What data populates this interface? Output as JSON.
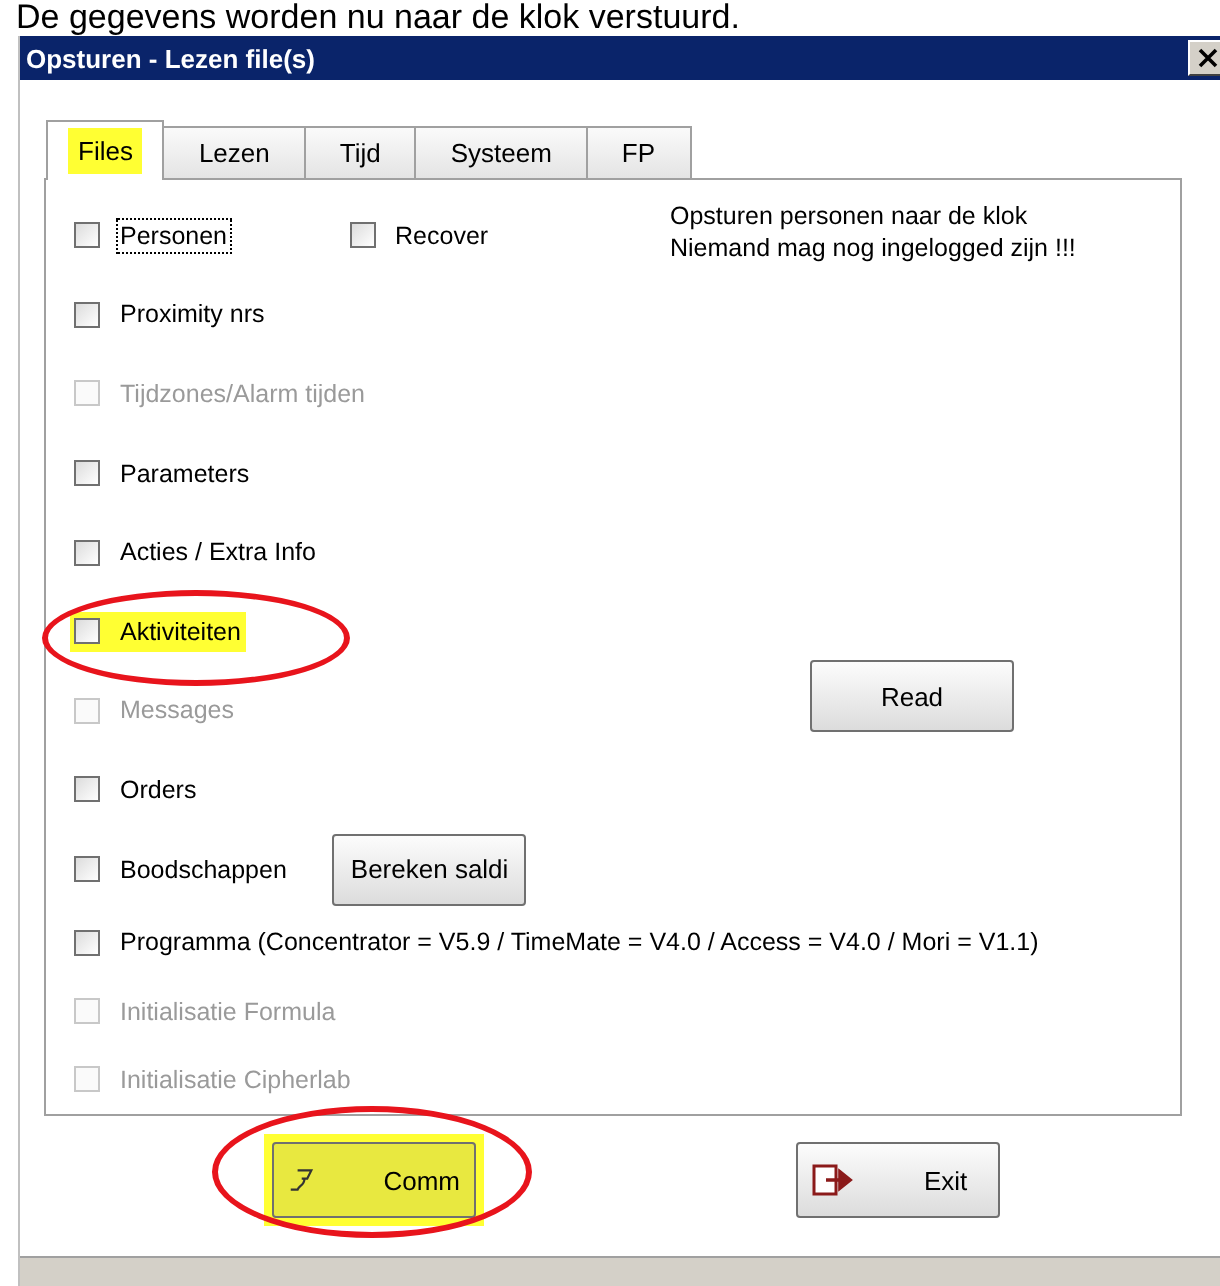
{
  "caption": "De gegevens worden nu naar de klok verstuurd.",
  "window": {
    "title": "Opsturen - Lezen  file(s)"
  },
  "tabs": [
    {
      "label": "Files",
      "selected": true,
      "highlighted": true
    },
    {
      "label": "Lezen",
      "selected": false,
      "highlighted": false
    },
    {
      "label": "Tijd",
      "selected": false,
      "highlighted": false
    },
    {
      "label": "Systeem",
      "selected": false,
      "highlighted": false
    },
    {
      "label": "FP",
      "selected": false,
      "highlighted": false
    }
  ],
  "info_text": [
    "Opsturen personen naar de klok",
    "Niemand mag nog ingelogged zijn !!!"
  ],
  "read_button": "Read",
  "rows": [
    {
      "items": [
        {
          "kind": "checkbox",
          "label": "Personen",
          "checked": false,
          "disabled": false,
          "focused": true,
          "highlighted": false,
          "circled": false
        },
        {
          "kind": "checkbox",
          "label": "Recover",
          "checked": false,
          "disabled": false,
          "focused": false,
          "highlighted": false,
          "circled": false
        }
      ]
    },
    {
      "items": [
        {
          "kind": "checkbox",
          "label": "Proximity nrs",
          "checked": false,
          "disabled": false,
          "focused": false,
          "highlighted": false,
          "circled": false
        }
      ]
    },
    {
      "items": [
        {
          "kind": "checkbox",
          "label": "Tijdzones/Alarm tijden",
          "checked": false,
          "disabled": true,
          "focused": false,
          "highlighted": false,
          "circled": false
        }
      ]
    },
    {
      "items": [
        {
          "kind": "checkbox",
          "label": "Parameters",
          "checked": false,
          "disabled": false,
          "focused": false,
          "highlighted": false,
          "circled": false
        }
      ]
    },
    {
      "items": [
        {
          "kind": "checkbox",
          "label": "Acties / Extra Info",
          "checked": false,
          "disabled": false,
          "focused": false,
          "highlighted": false,
          "circled": false
        }
      ]
    },
    {
      "items": [
        {
          "kind": "checkbox",
          "label": "Aktiviteiten",
          "checked": false,
          "disabled": false,
          "focused": false,
          "highlighted": true,
          "circled": true
        }
      ]
    },
    {
      "items": [
        {
          "kind": "checkbox",
          "label": "Messages",
          "checked": false,
          "disabled": true,
          "focused": false,
          "highlighted": false,
          "circled": false
        }
      ]
    },
    {
      "items": [
        {
          "kind": "checkbox",
          "label": "Orders",
          "checked": false,
          "disabled": false,
          "focused": false,
          "highlighted": false,
          "circled": false
        }
      ]
    },
    {
      "items": [
        {
          "kind": "checkbox",
          "label": "Boodschappen",
          "checked": false,
          "disabled": false,
          "focused": false,
          "highlighted": false,
          "circled": false
        },
        {
          "kind": "button",
          "label": "Bereken saldi"
        }
      ]
    },
    {
      "items": [
        {
          "kind": "checkbox",
          "label": "Programma (Concentrator = V5.9 / TimeMate = V4.0 / Access = V4.0 / Mori = V1.1)",
          "checked": false,
          "disabled": false,
          "focused": false,
          "highlighted": false,
          "circled": false
        }
      ]
    },
    {
      "items": [
        {
          "kind": "checkbox",
          "label": "Initialisatie Formula",
          "checked": false,
          "disabled": true,
          "focused": false,
          "highlighted": false,
          "circled": false
        }
      ]
    },
    {
      "items": [
        {
          "kind": "checkbox",
          "label": "Initialisatie Cipherlab",
          "checked": false,
          "disabled": true,
          "focused": false,
          "highlighted": false,
          "circled": false
        }
      ]
    }
  ],
  "buttons": [
    {
      "kind": "comm",
      "label": "Comm",
      "highlighted": true,
      "circled": true
    },
    {
      "kind": "exit",
      "label": "Exit",
      "highlighted": false,
      "circled": false
    }
  ]
}
